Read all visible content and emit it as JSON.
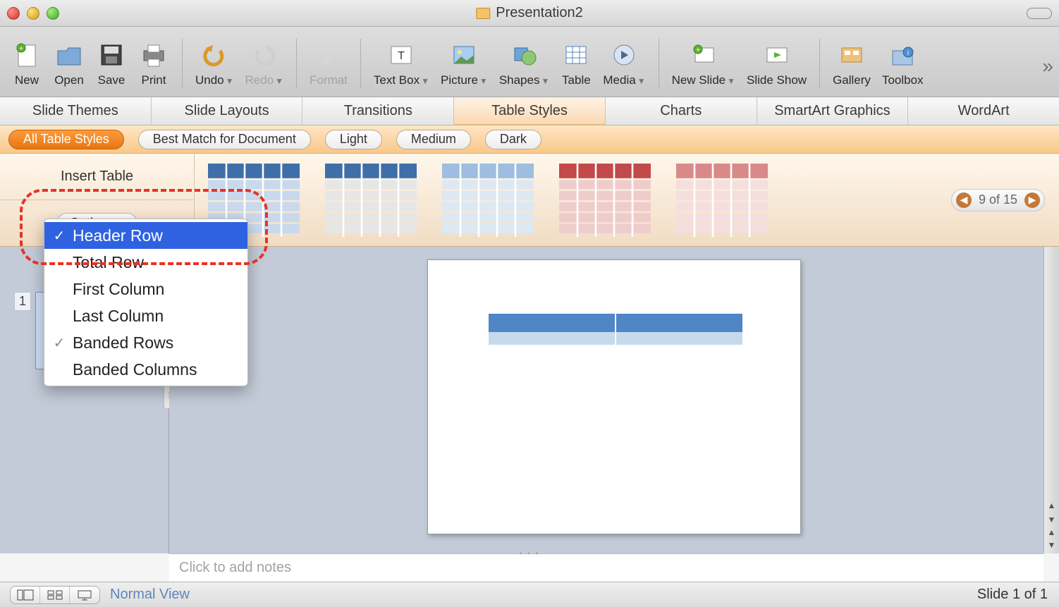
{
  "window": {
    "title": "Presentation2"
  },
  "toolbar": {
    "new": "New",
    "open": "Open",
    "save": "Save",
    "print": "Print",
    "undo": "Undo",
    "redo": "Redo",
    "format": "Format",
    "textbox": "Text Box",
    "picture": "Picture",
    "shapes": "Shapes",
    "table": "Table",
    "media": "Media",
    "newslide": "New Slide",
    "slideshow": "Slide Show",
    "gallery": "Gallery",
    "toolbox": "Toolbox"
  },
  "ribbon_tabs": {
    "themes": "Slide Themes",
    "layouts": "Slide Layouts",
    "transitions": "Transitions",
    "tablestyles": "Table Styles",
    "charts": "Charts",
    "smartart": "SmartArt Graphics",
    "wordart": "WordArt"
  },
  "subribbon": {
    "all": "All Table Styles",
    "best": "Best Match for Document",
    "light": "Light",
    "medium": "Medium",
    "dark": "Dark"
  },
  "gallery": {
    "insert_table": "Insert Table",
    "options": "Options",
    "nav": "9 of 15"
  },
  "options_menu": {
    "header_row": "Header Row",
    "total_row": "Total Row",
    "first_col": "First Column",
    "last_col": "Last Column",
    "banded_rows": "Banded Rows",
    "banded_cols": "Banded Columns"
  },
  "slide_panel": {
    "slide1_num": "1"
  },
  "notes": {
    "placeholder": "Click to add notes"
  },
  "statusbar": {
    "view_label": "Normal View",
    "slide_count": "Slide 1 of 1"
  },
  "colors": {
    "thumb_blue_hdr": "#3f6fa8",
    "thumb_blue_cell": "#c8d9ee",
    "thumb_gray_hdr": "#6a6a6a",
    "thumb_gray_cell": "#e0e0e0",
    "thumb_red_hdr": "#c24a4a",
    "thumb_red_cell": "#efcccc"
  }
}
